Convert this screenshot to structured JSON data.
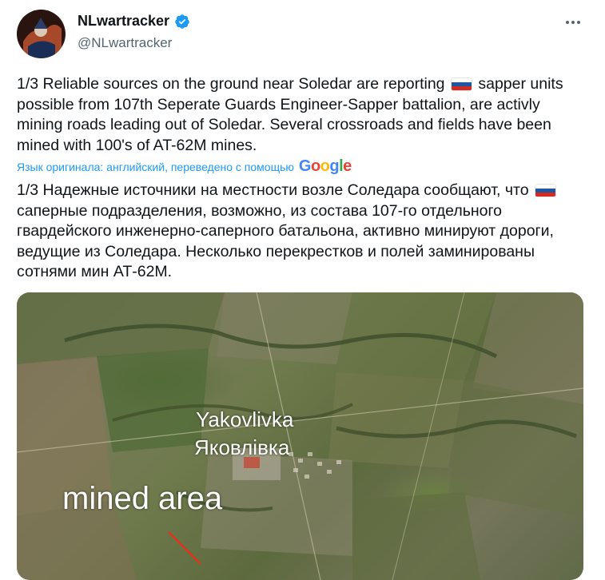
{
  "author": {
    "name": "NLwartracker",
    "handle": "@NLwartracker",
    "verified": true
  },
  "tweet": {
    "text_original_a": "1/3 Reliable sources on the ground near Soledar are reporting",
    "text_original_b": "sapper units possible from 107th Seperate Guards Engineer-Sapper battalion, are activly mining roads leading out of Soledar. Several crossroads and fields have been mined with 100's of AT-62M mines.",
    "translation_note": "Язык оригинала: английский, переведено с помощью",
    "translation_provider": "Google",
    "text_translated_a": "1/3 Надежные источники на местности возле Соледара сообщают, что",
    "text_translated_b": "саперные подразделения, возможно, из состава 107-го отдельного гвардейского инженерно-саперного батальона, активно минируют дороги, ведущие из Соледара. Несколько перекрестков и полей заминированы сотнями мин АТ-62М."
  },
  "media": {
    "label_en": "Yakovlivka",
    "label_uk": "Яковлівка",
    "label_area": "mined area"
  },
  "icons": {
    "verified": "verified-badge-icon",
    "more": "more-options-icon",
    "flag": "russia-flag-icon"
  },
  "colors": {
    "accent": "#1d9bf0",
    "text": "#0f1419",
    "secondary": "#536471"
  }
}
